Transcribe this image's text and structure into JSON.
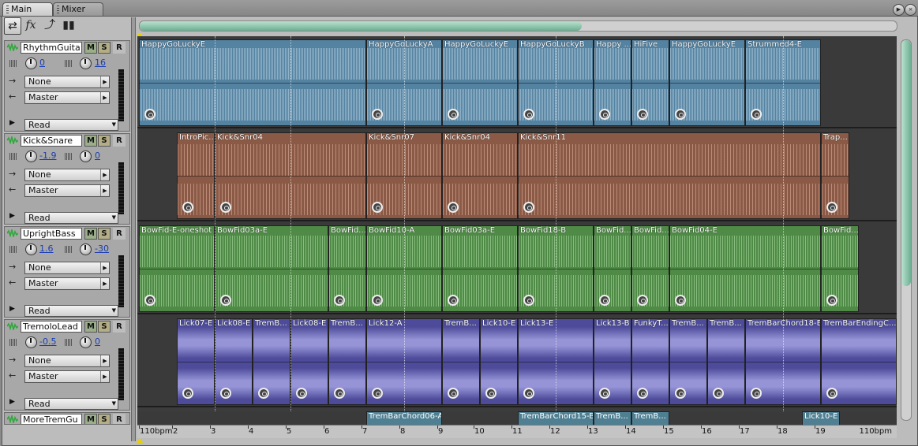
{
  "tabs": [
    {
      "label": "Main",
      "active": true
    },
    {
      "label": "Mixer",
      "active": false
    }
  ],
  "tracks": [
    {
      "name": "RhythmGuita",
      "m": "M",
      "s": "S",
      "r": "R",
      "vol": "0",
      "pan": "16",
      "send": "None",
      "out": "Master",
      "auto": "Read"
    },
    {
      "name": "Kick&Snare",
      "m": "M",
      "s": "S",
      "r": "R",
      "vol": "-1.9",
      "pan": "0",
      "send": "None",
      "out": "Master",
      "auto": "Read"
    },
    {
      "name": "UprightBass",
      "m": "M",
      "s": "S",
      "r": "R",
      "vol": "1.6",
      "pan": "-30",
      "send": "None",
      "out": "Master",
      "auto": "Read"
    },
    {
      "name": "TremoloLead",
      "m": "M",
      "s": "S",
      "r": "R",
      "vol": "-0.5",
      "pan": "0",
      "send": "None",
      "out": "Master",
      "auto": "Read"
    },
    {
      "name": "MoreTremGu",
      "m": "M",
      "s": "S",
      "r": "R"
    }
  ],
  "lanes": [
    {
      "color": "#5482a1",
      "clips": [
        "HappyGoLuckyE",
        "HappyGoLuckyA",
        "HappyGoLuckyE",
        "HappyGoLuckyB",
        "Happy ...",
        "HiFive",
        "HappyGoLuckyE",
        "Strummed4-E"
      ]
    },
    {
      "color": "#8a5a46",
      "clips": [
        "IntroPic...",
        "Kick&Snr04",
        "Kick&Snr07",
        "Kick&Snr04",
        "Kick&Snr11",
        "Trap..."
      ]
    },
    {
      "color": "#4f8a46",
      "clips": [
        "BowFid-E-oneshot",
        "BowFid03a-E",
        "BowFid...",
        "BowFid10-A",
        "BowFid03a-E",
        "BowFid18-B",
        "BowFid...",
        "BowFid...",
        "BowFid04-E",
        "BowFid..."
      ]
    },
    {
      "color": "#4e4c9a",
      "clips": [
        "Lick07-E",
        "Lick08-E",
        "TremB...",
        "Lick08-E",
        "TremB...",
        "Lick12-A",
        "TremB...",
        "Lick10-E",
        "Lick13-E",
        "Lick13-B",
        "FunkyT...",
        "TremB...",
        "TremB...",
        "TremBarChord18-E",
        "TremBarEndingC..."
      ]
    },
    {
      "color": "#4f7f92",
      "clips": [
        "TremBarChord06-A",
        "TremBarChord15-B",
        "TremB...",
        "TremB...",
        "Lick10-E"
      ]
    }
  ],
  "ruler": {
    "start": "110bpm",
    "end": "110bpm",
    "bars": [
      "2",
      "3",
      "4",
      "5",
      "6",
      "7",
      "8",
      "9",
      "10",
      "11",
      "12",
      "13",
      "14",
      "15",
      "16",
      "17",
      "18",
      "19"
    ]
  },
  "icons": {
    "toolbar": [
      "loop-icon",
      "fx-icon",
      "branch-icon",
      "bars-icon"
    ]
  }
}
